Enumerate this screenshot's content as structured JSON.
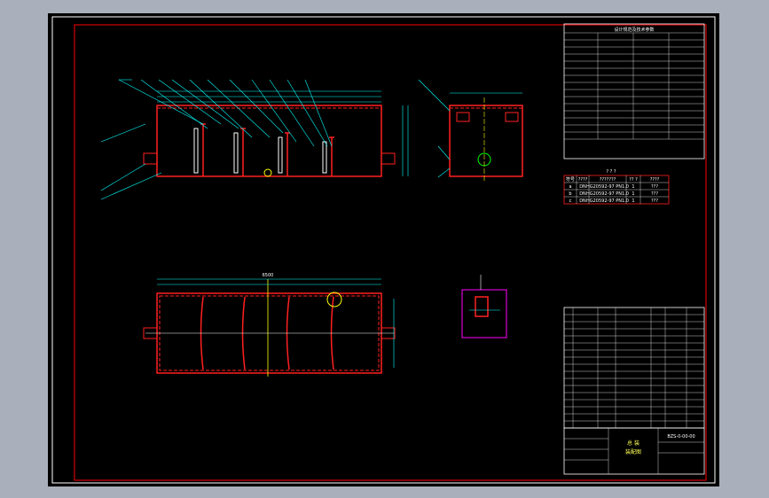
{
  "drawing": {
    "spec_title": "设计规范及技术参数",
    "nozzle_table_title": "? ? ?",
    "nozzle_table": {
      "headers": [
        "符号",
        "????",
        "???????",
        "?? ?",
        "????"
      ],
      "rows": [
        [
          "a",
          "DN",
          "HG20592-97 PN1.0",
          "1",
          "???"
        ],
        [
          "b",
          "DN",
          "HG20592-97 PN1.0",
          "1",
          "???"
        ],
        [
          "c",
          "DN",
          "HG20592-97 PN1.0",
          "1",
          "???"
        ]
      ]
    },
    "plan_dimension": "6500",
    "title_block": {
      "line1": "总 装",
      "line2": "装配图",
      "drawing_number": "BZS-0-00-00"
    }
  },
  "colors": {
    "background": "#000000",
    "frame": "#ffffff",
    "border": "#ff0000",
    "vessel": "#ff2020",
    "dimension": "#00ffff",
    "centerline": "#ffff00",
    "flange": "#ff00ff",
    "text": "#ffffff",
    "green": "#00ff00"
  }
}
